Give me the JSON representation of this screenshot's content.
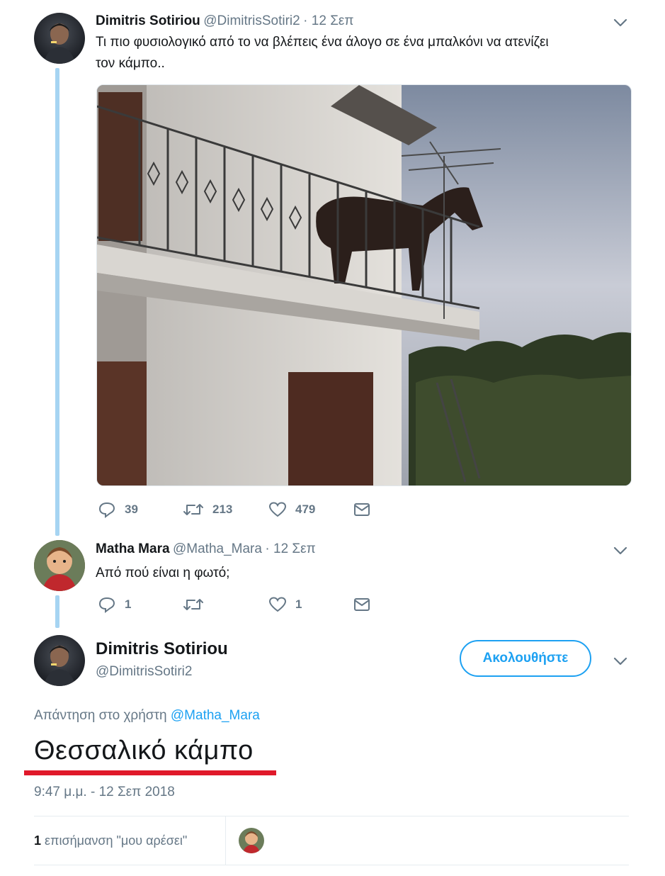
{
  "tweet1": {
    "name": "Dimitris Sotiriou",
    "handle": "@DimitrisSotiri2",
    "date": "· 12 Σεπ",
    "text_line1": "Τι πιο φυσιολογικό από το να βλέπεις ένα άλογο σε ένα μπαλκόνι να ατενίζει",
    "text_line2": "τον κάμπο..",
    "replies": "39",
    "retweets": "213",
    "likes": "479"
  },
  "tweet2": {
    "name": "Matha Mara",
    "handle": "@Matha_Mara",
    "date": "· 12 Σεπ",
    "text": "Από πού είναι η φωτό;",
    "replies": "1",
    "likes": "1"
  },
  "main": {
    "name": "Dimitris Sotiriou",
    "handle": "@DimitrisSotiri2",
    "follow_label": "Ακολουθήστε",
    "reply_prefix": "Απάντηση στο χρήστη",
    "reply_to": "@Matha_Mara",
    "text": "Θεσσαλικό κάμπο",
    "timestamp": "9:47 μ.μ. - 12 Σεπ 2018",
    "likes_count": "1",
    "likes_label": "επισήμανση \"μου αρέσει\""
  },
  "colors": {
    "accent": "#1da1f2",
    "thread_line": "#a6d4f2",
    "muted": "#657786",
    "underline": "#e0192a"
  },
  "icons": [
    "reply-icon",
    "retweet-icon",
    "like-icon",
    "dm-icon",
    "chevron-down-icon"
  ]
}
